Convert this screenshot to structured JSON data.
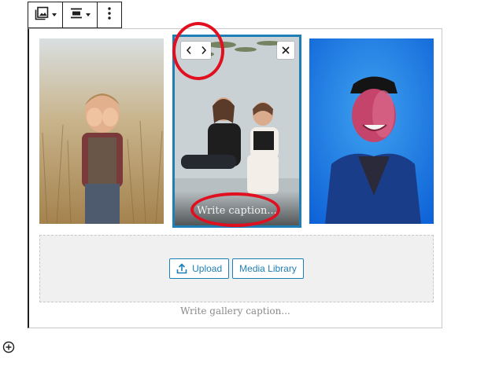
{
  "toolbar": {
    "block_type_icon": "gallery-icon",
    "align_icon": "align-center-icon",
    "more_icon": "kebab-menu-icon"
  },
  "gallery": {
    "images": [
      {
        "alt": "Child covering face in tall grass",
        "selected": false
      },
      {
        "alt": "Two women laughing, sitting on floor",
        "selected": true,
        "caption_placeholder": "Write caption..."
      },
      {
        "alt": "Man laughing under blue and pink light",
        "selected": false
      }
    ],
    "controls": {
      "move_left_icon": "chevron-left-icon",
      "move_right_icon": "chevron-right-icon",
      "remove_icon": "close-icon"
    },
    "upload_label": "Upload",
    "media_library_label": "Media Library",
    "caption_placeholder": "Write gallery caption..."
  },
  "inserter_icon": "plus-circle-icon",
  "colors": {
    "accent": "#1e7fb6",
    "annotation": "#e01020",
    "placeholder_bg": "#f0f0f0"
  }
}
